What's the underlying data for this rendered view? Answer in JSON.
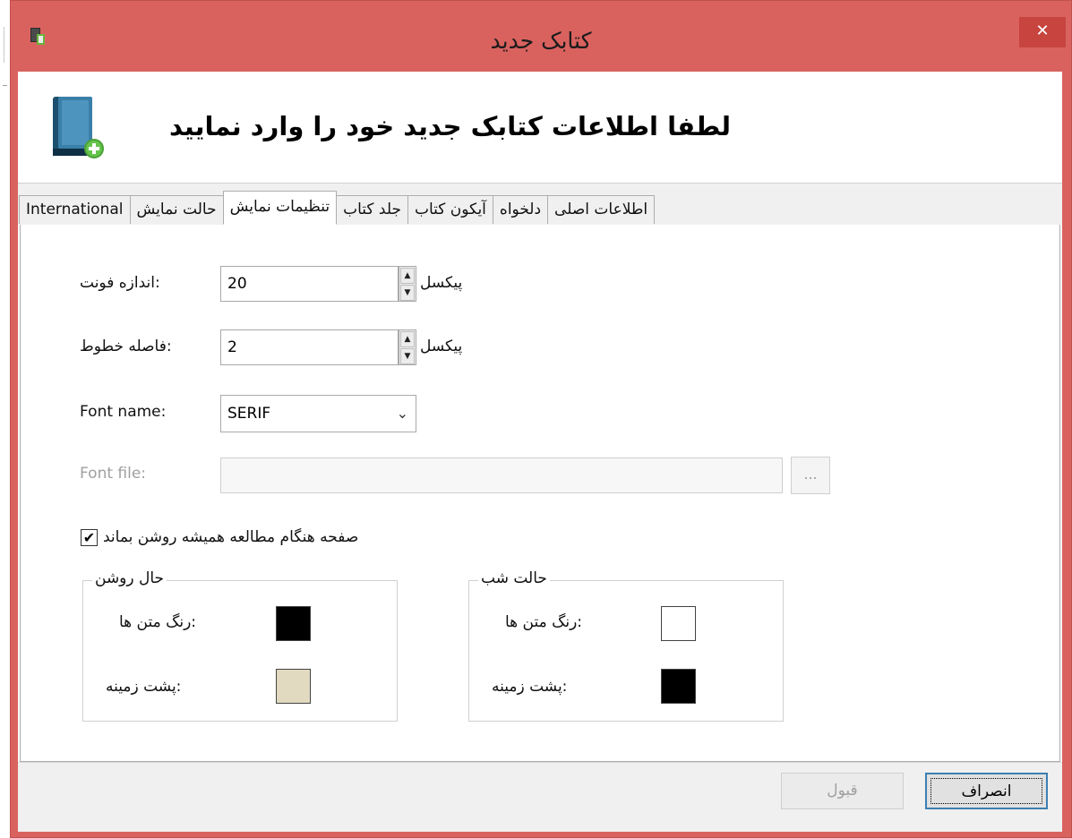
{
  "window": {
    "title": "کتابک جدید",
    "close_glyph": "✕",
    "accent_color": "#d9625f"
  },
  "header": {
    "message": "لطفا اطلاعات کتابک جدید  خود را وارد نمایید",
    "icon": "book-add-icon"
  },
  "tabs": [
    {
      "label": "اطلاعات اصلی",
      "active": false
    },
    {
      "label": "دلخواه",
      "active": false
    },
    {
      "label": "آیکون کتاب",
      "active": false
    },
    {
      "label": "جلد کتاب",
      "active": false
    },
    {
      "label": "تنظیمات نمایش",
      "active": true
    },
    {
      "label": "حالت نمایش",
      "active": false
    },
    {
      "label": "International",
      "active": false
    }
  ],
  "display_settings": {
    "font_size": {
      "label": ":اندازه فونت",
      "value": "20",
      "unit": "پیکسل"
    },
    "line_spacing": {
      "label": ":فاصله خطوط",
      "value": "2",
      "unit": "پیکسل"
    },
    "font_name": {
      "label": "Font name:",
      "value": "SERIF"
    },
    "font_file": {
      "label": "Font file:",
      "value": "",
      "browse_label": "..."
    },
    "keep_screen_on": {
      "label": "صفحه هنگام مطالعه همیشه روشن بماند",
      "checked": true
    },
    "day_mode": {
      "title": "حال روشن",
      "text_color_label": ":رنگ متن ها",
      "text_color": "#000000",
      "background_label": ":پشت زمینه",
      "background_color": "#e1d9c0"
    },
    "night_mode": {
      "title": "حالت شب",
      "text_color_label": ":رنگ متن ها",
      "text_color": "#ffffff",
      "background_label": ":پشت زمینه",
      "background_color": "#000000"
    }
  },
  "footer": {
    "cancel_label": "انصراف",
    "ok_label": "قبول"
  }
}
